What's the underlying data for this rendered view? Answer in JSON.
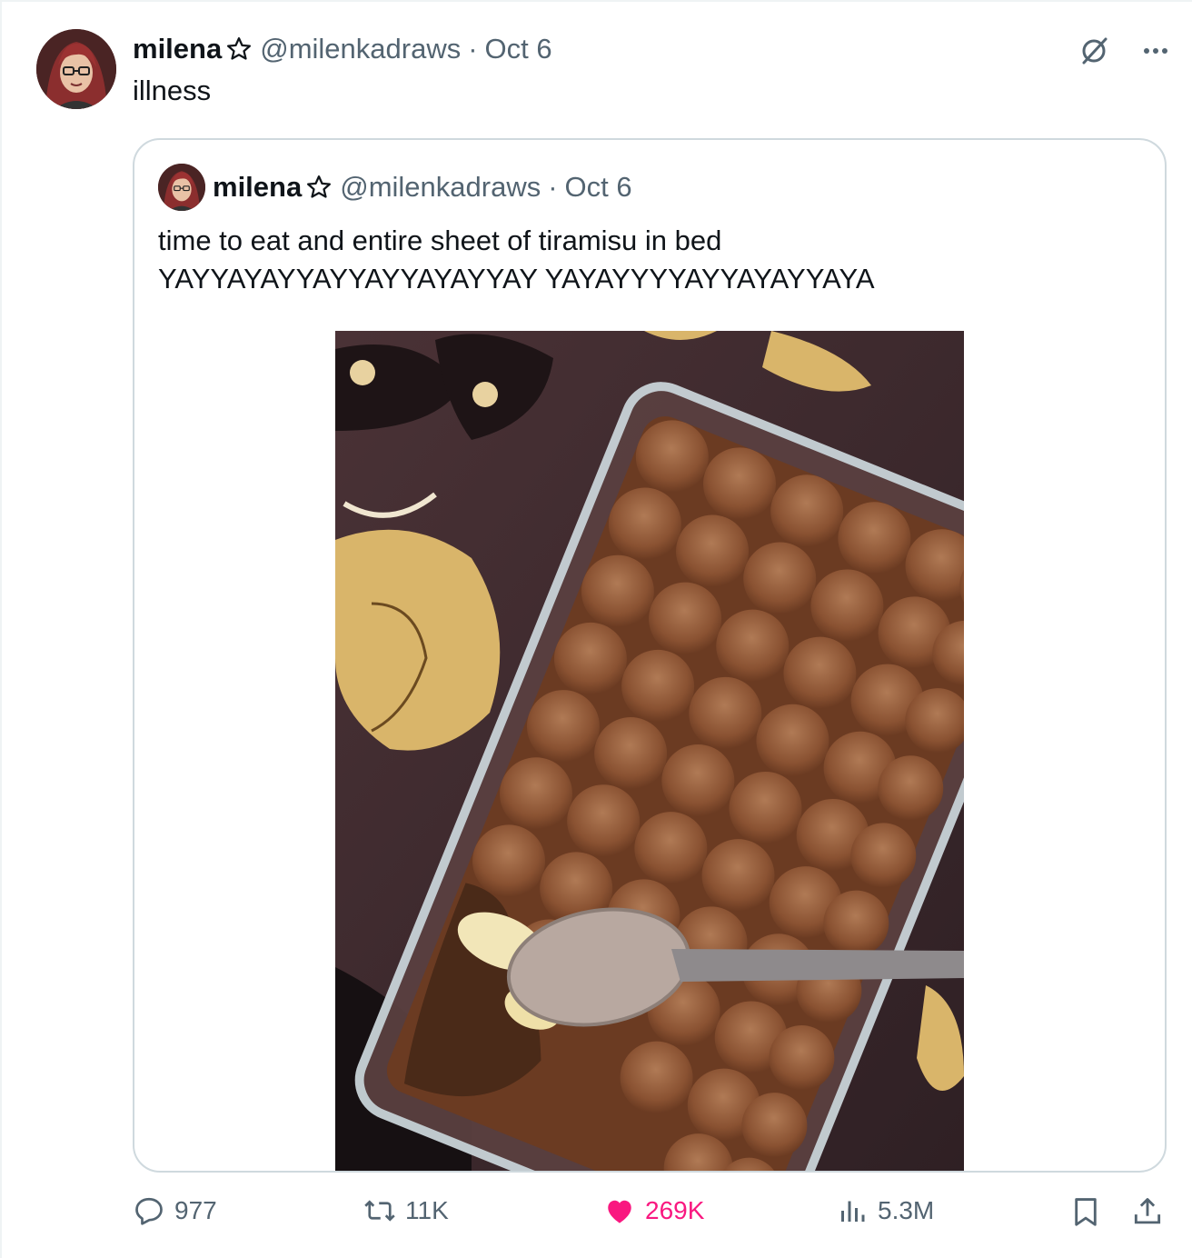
{
  "tweet": {
    "author_name": "milena",
    "handle": "@milenkadraws",
    "date": "Oct 6",
    "separator": "·",
    "text": "illness"
  },
  "quoted": {
    "author_name": "milena",
    "handle": "@milenkadraws",
    "date": "Oct 6",
    "separator": "·",
    "text_line1": "time to eat and entire sheet of tiramisu in bed",
    "text_line2": "YAYYAYAYYAYYAYYAYAYYAY YAYAYYYYAYYAYAYYAYA"
  },
  "stats": {
    "replies": "977",
    "reposts": "11K",
    "likes": "269K",
    "views": "5.3M"
  },
  "icons": {
    "reply": "reply-icon",
    "repost": "repost-icon",
    "like": "heart-icon",
    "views": "views-icon",
    "bookmark": "bookmark-icon",
    "share": "share-icon",
    "grok": "grok-icon",
    "more": "more-icon",
    "verified_star": "star-icon"
  },
  "colors": {
    "text": "#0f1419",
    "secondary": "#536471",
    "like": "#f91880",
    "border": "#cfd9de"
  }
}
